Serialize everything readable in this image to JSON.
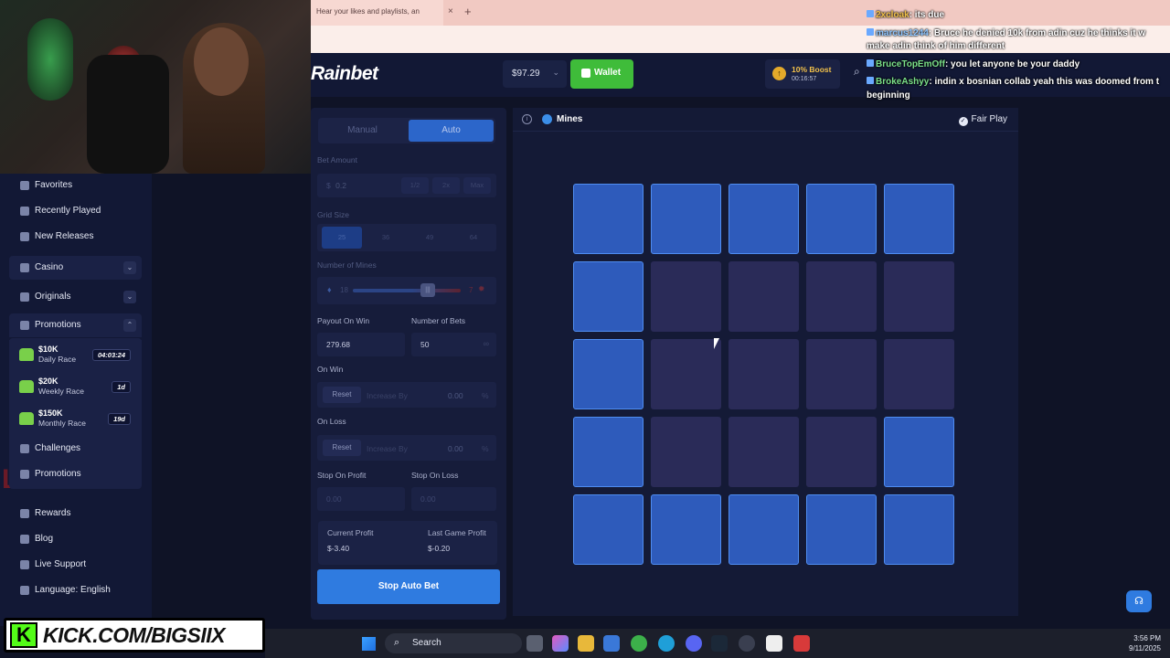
{
  "browser": {
    "tab_title": "Hear your likes and playlists, an",
    "tab_close": "×",
    "tab_new": "+"
  },
  "header": {
    "logo": "Rainbet",
    "balance": "$97.29",
    "wallet_label": "Wallet",
    "boost_title": "10% Boost",
    "boost_timer": "00:16:57"
  },
  "sidebar": {
    "items_top": [
      {
        "label": "Favorites"
      },
      {
        "label": "Recently Played"
      },
      {
        "label": "New Releases"
      }
    ],
    "casino": "Casino",
    "originals": "Originals",
    "promotions_header": "Promotions",
    "races": [
      {
        "amount": "$10K",
        "name": "Daily Race",
        "badge": "04:03:24"
      },
      {
        "amount": "$20K",
        "name": "Weekly Race",
        "badge": "1d"
      },
      {
        "amount": "$150K",
        "name": "Monthly Race",
        "badge": "19d"
      }
    ],
    "challenges": "Challenges",
    "promotions": "Promotions",
    "bottom": [
      {
        "label": "Rewards"
      },
      {
        "label": "Blog"
      },
      {
        "label": "Live Support"
      },
      {
        "label": "Language: English"
      }
    ],
    "overlay_text": "LAN"
  },
  "bet": {
    "mode_manual": "Manual",
    "mode_auto": "Auto",
    "bet_amount_label": "Bet Amount",
    "bet_amount": "0.2",
    "bet_amount_prefix": "$",
    "bet_chips": [
      "1/2",
      "2x",
      "Max"
    ],
    "grid_size_label": "Grid Size",
    "grid_sizes": [
      "25",
      "36",
      "49",
      "64"
    ],
    "mines_label": "Number of Mines",
    "mines_safe": "18",
    "mines_count": "7",
    "payout_label": "Payout On Win",
    "payout_value": "279.68",
    "num_bets_label": "Number of Bets",
    "num_bets_value": "50",
    "on_win_label": "On Win",
    "on_loss_label": "On Loss",
    "reset_label": "Reset",
    "increase_by": "Increase By",
    "zero": "0.00",
    "percent": "%",
    "stop_profit_label": "Stop On Profit",
    "stop_loss_label": "Stop On Loss",
    "current_profit_label": "Current Profit",
    "current_profit": "$-3.40",
    "last_game_label": "Last Game Profit",
    "last_game_profit": "$-0.20",
    "stop_auto_label": "Stop Auto Bet"
  },
  "game": {
    "title": "Mines",
    "fair_play": "Fair Play",
    "grid": [
      [
        1,
        1,
        1,
        1,
        1
      ],
      [
        1,
        0,
        0,
        0,
        0
      ],
      [
        1,
        0,
        0,
        0,
        0
      ],
      [
        1,
        0,
        0,
        0,
        1
      ],
      [
        1,
        1,
        1,
        1,
        1
      ]
    ]
  },
  "chat": [
    {
      "user": "2xcloak",
      "text": ": its due",
      "cls": ""
    },
    {
      "user": "marcus1244",
      "text": ": Bruce he denied 10k from adin cuz he thinks it w",
      "cls": "b"
    },
    {
      "user": "",
      "text": "make adin think of him different",
      "cls": ""
    },
    {
      "user": "BruceTopEmOff",
      "text": ": you let anyone be your daddy",
      "cls": "g"
    },
    {
      "user": "BrokeAshyy",
      "text": ": indin x bosnian collab yeah this was doomed from t",
      "cls": "g"
    },
    {
      "user": "",
      "text": "beginning",
      "cls": ""
    }
  ],
  "kick": {
    "k": "K",
    "text": "KICK.COM/BIGSIIX"
  },
  "taskbar": {
    "search": "Search",
    "time": "3:56 PM",
    "date": "9/11/2025"
  }
}
